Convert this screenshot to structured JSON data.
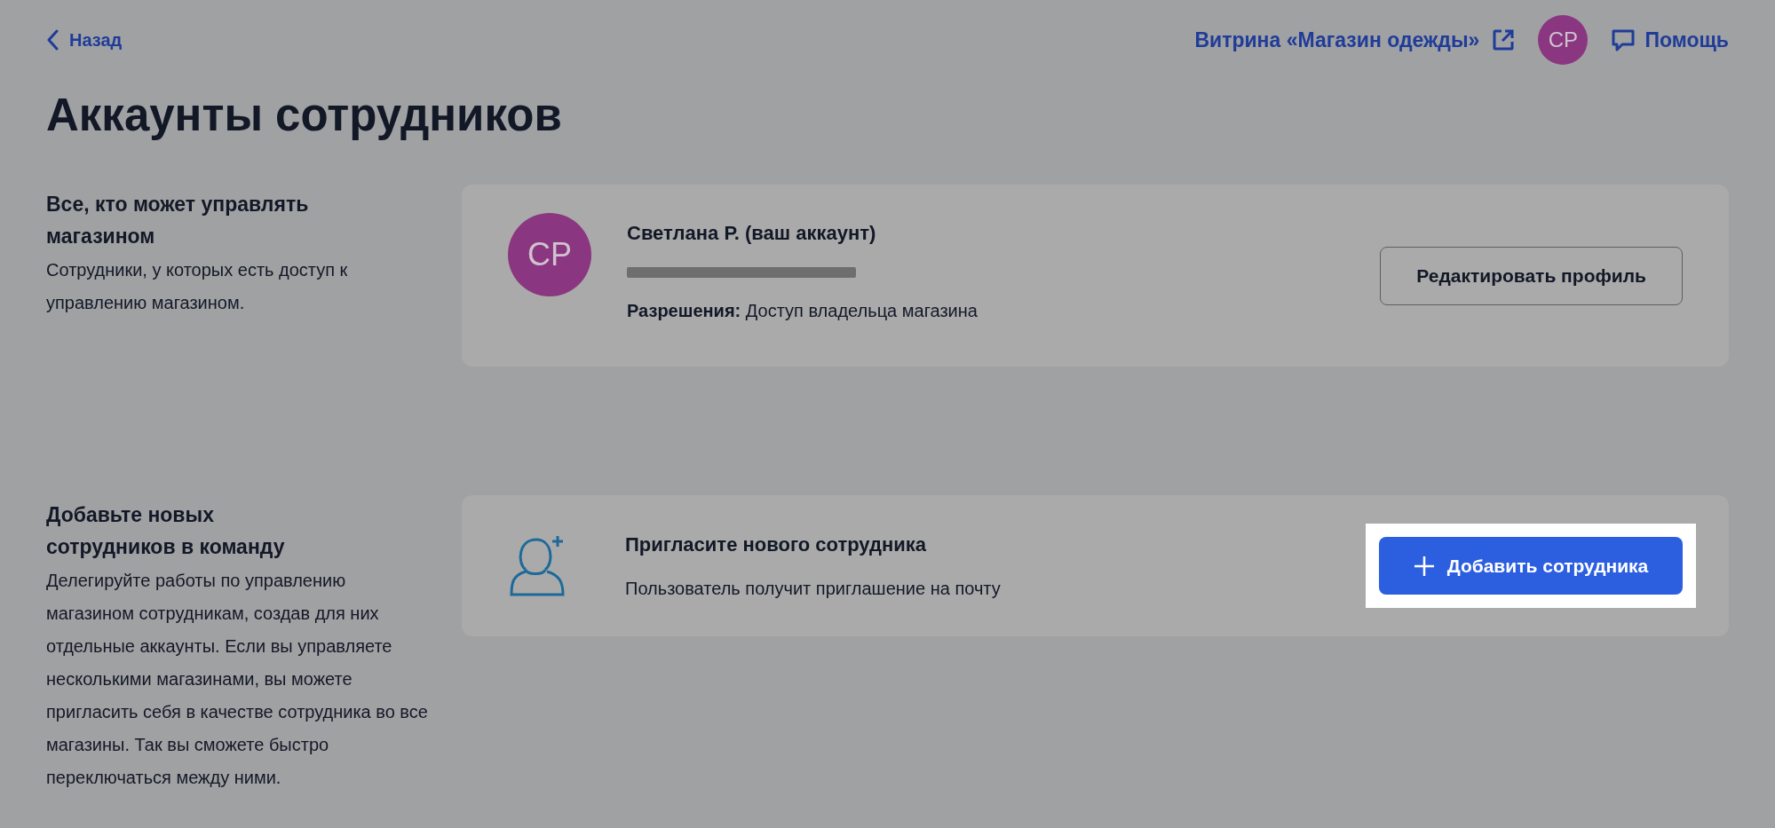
{
  "header": {
    "back_link": "Назад",
    "storefront_link": "Витрина «Магазин одежды»",
    "avatar_initials": "СР",
    "help_link": "Помощь"
  },
  "title": "Аккаунты сотрудников",
  "sections": [
    {
      "kind": "account",
      "heading": "Все, кто может управлять магазином",
      "description": "Сотрудники, у которых есть доступ к управлению магазином.",
      "avatar_initials": "СР",
      "name": "Светлана Р. (ваш аккаунт)",
      "email_redacted": true,
      "permissions_label": "Разрешения:",
      "permissions_value": "Доступ владельца магазина",
      "button": "Редактировать профиль"
    },
    {
      "kind": "invite",
      "heading": "Добавьте новых сотрудников в команду",
      "description": "Делегируйте работы по управлению магазином сотрудникам, создав для них отдельные аккаунты. Если вы управляете несколькими магазинами, вы можете пригласить себя в качестве сотрудника во все магазины. Так вы сможете быстро переключаться между ними.",
      "name": "Пригласите нового сотрудника",
      "subtitle": "Пользователь получит приглашение на почту",
      "button": "Добавить сотрудника",
      "highlighted": true
    }
  ]
}
